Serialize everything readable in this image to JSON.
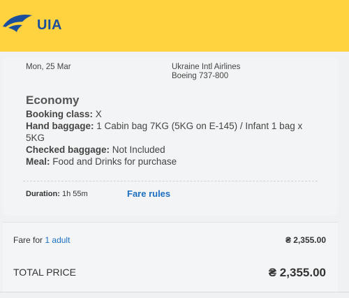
{
  "header": {
    "brand": "UIA",
    "logo_icon": "uia-plane-tail-icon",
    "background_color": "#ffd23f",
    "brand_color": "#1b4e9b"
  },
  "flight": {
    "date": "Mon, 25 Mar",
    "airline": "Ukraine Intl Airlines",
    "aircraft": "Boeing 737-800"
  },
  "fare": {
    "class_name": "Economy",
    "booking_class_label": "Booking class:",
    "booking_class_value": "X",
    "hand_baggage_label": "Hand baggage:",
    "hand_baggage_value": "1 Cabin bag 7KG (5KG on E-145) / Infant 1 bag x",
    "hand_baggage_value_line2": "5KG",
    "checked_baggage_label": "Checked baggage:",
    "checked_baggage_value": "Not Included",
    "meal_label": "Meal:",
    "meal_value": "Food and Drinks for purchase"
  },
  "duration": {
    "label": "Duration:",
    "value": "1h 55m"
  },
  "fare_rules_link": "Fare rules",
  "pricing": {
    "fare_for_prefix": "Fare for",
    "passenger_count": "1",
    "passenger_type": "adult",
    "fare_amount": "₴ 2,355.00",
    "total_label": "TOTAL PRICE",
    "total_amount": "₴ 2,355.00"
  },
  "colors": {
    "link": "#1b6fc2",
    "panel_bg": "#f3f4f5"
  }
}
